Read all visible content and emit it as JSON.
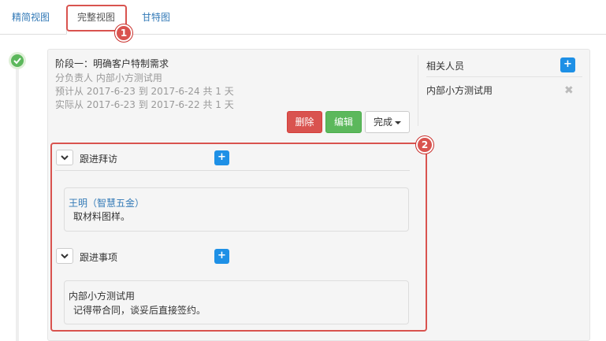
{
  "tabs": [
    {
      "label": "精简视图"
    },
    {
      "label": "完整视图"
    },
    {
      "label": "甘特图"
    }
  ],
  "callouts": [
    "1",
    "2"
  ],
  "stage": {
    "title": "阶段一：明确客户特制需求",
    "owner_line": "分负责人 内部小方测试用",
    "planned_line": "预计从 2017-6-23 到 2017-6-24 共 1 天",
    "actual_line": "实际从 2017-6-23 到 2017-6-22 共 1 天",
    "buttons": {
      "delete": "删除",
      "edit": "编辑",
      "done": "完成"
    }
  },
  "related": {
    "title": "相关人员",
    "add_label": "+",
    "person": "内部小方测试用",
    "remove_label": "✖"
  },
  "sections": [
    {
      "title": "跟进拜访",
      "add_label": "+",
      "entry": {
        "name": "王明（智慧五金）",
        "text": "取材料图样。"
      }
    },
    {
      "title": "跟进事项",
      "add_label": "+",
      "entry": {
        "name": "内部小方测试用",
        "text": "记得带合同，谈妥后直接签约。"
      }
    }
  ],
  "colors": {
    "accent": "#337ab7",
    "danger": "#d9534f",
    "success": "#5cb85c",
    "primary": "#1e90e6"
  }
}
